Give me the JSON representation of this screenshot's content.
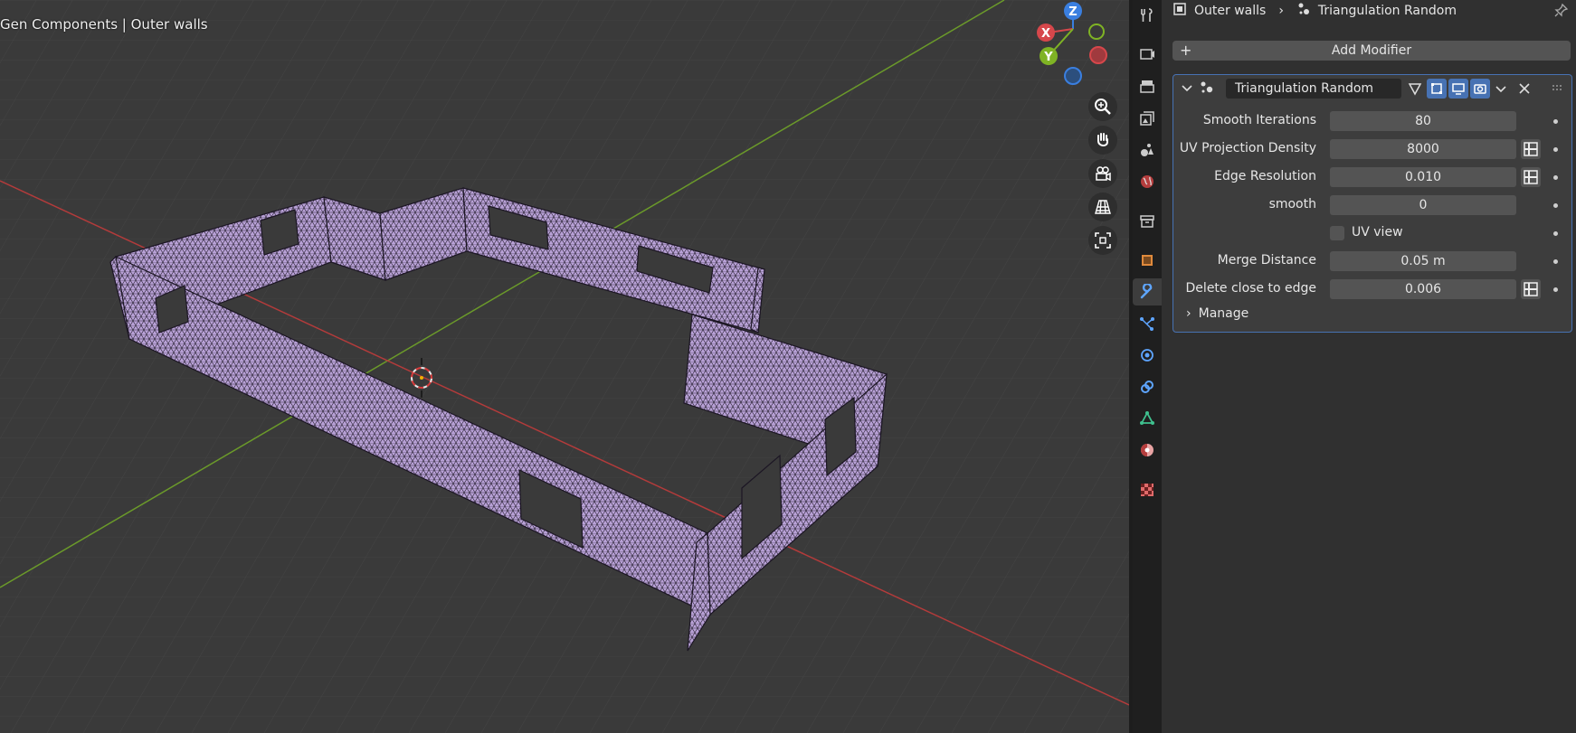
{
  "viewport": {
    "title_collection": "Gen Components",
    "title_separator": " | ",
    "title_object": "Outer walls",
    "gizmo_axes": [
      "Z",
      "X",
      "Y"
    ],
    "nav_buttons": [
      "zoom-icon",
      "hand-icon",
      "camera-icon",
      "grid-icon",
      "frame-icon"
    ],
    "colors": {
      "background": "#3a3a3a",
      "mesh_fill": "#b8a1d6",
      "x_axis": "#b33b3b",
      "y_axis": "#6b9a2a"
    }
  },
  "properties": {
    "breadcrumb": {
      "object": "Outer walls",
      "modifier": "Triangulation Random"
    },
    "add_modifier_label": "Add Modifier",
    "modifier": {
      "name": "Triangulation Random",
      "fields": [
        {
          "label": "Smooth Iterations",
          "value": "80",
          "driver": false
        },
        {
          "label": "UV Projection Density",
          "value": "8000",
          "driver": true
        },
        {
          "label": "Edge Resolution",
          "value": "0.010",
          "driver": true
        },
        {
          "label": "smooth",
          "value": "0",
          "driver": false
        },
        {
          "label": "Merge Distance",
          "value": "0.05 m",
          "driver": false
        },
        {
          "label": "Delete close to edge",
          "value": "0.006",
          "driver": true
        }
      ],
      "checkbox": {
        "label": "UV view",
        "checked": false
      },
      "manage_label": "Manage"
    },
    "accent_color": "#4772b3"
  },
  "tabs": [
    "tool-icon",
    "render-icon",
    "output-icon",
    "view-layer-icon",
    "scene-icon",
    "world-icon",
    "collection-icon",
    "object-icon",
    "modifier-icon",
    "particles-icon",
    "physics-icon",
    "constraints-icon",
    "data-icon",
    "material-icon",
    "texture-icon"
  ]
}
